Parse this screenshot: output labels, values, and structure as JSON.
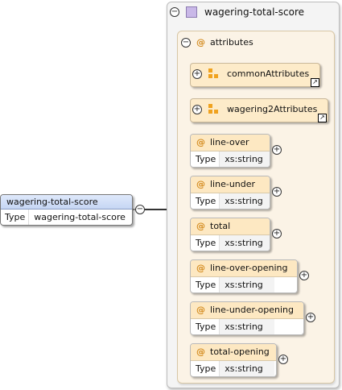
{
  "root_element": {
    "name": "wagering-total-score",
    "type_label": "Type",
    "type_value": "wagering-total-score"
  },
  "complex_type": {
    "name": "wagering-total-score"
  },
  "attributes_group": {
    "label": "attributes"
  },
  "attribute_groups": [
    {
      "name": "commonAttributes"
    },
    {
      "name": "wagering2Attributes"
    }
  ],
  "attributes": [
    {
      "name": "line-over",
      "type_label": "Type",
      "type_value": "xs:string"
    },
    {
      "name": "line-under",
      "type_label": "Type",
      "type_value": "xs:string"
    },
    {
      "name": "total",
      "type_label": "Type",
      "type_value": "xs:string"
    },
    {
      "name": "line-over-opening",
      "type_label": "Type",
      "type_value": "xs:string"
    },
    {
      "name": "line-under-opening",
      "type_label": "Type",
      "type_value": "xs:string"
    },
    {
      "name": "total-opening",
      "type_label": "Type",
      "type_value": "xs:string"
    }
  ],
  "symbols": {
    "attribute": "@",
    "expand": "+",
    "collapse": "−"
  },
  "colors": {
    "attribute_header": "#fde8c2",
    "group_bg": "#fdebc9",
    "root_header": "#c6d6f4",
    "icon_orange": "#f0a21e",
    "type_icon": "#c9b8e8"
  }
}
